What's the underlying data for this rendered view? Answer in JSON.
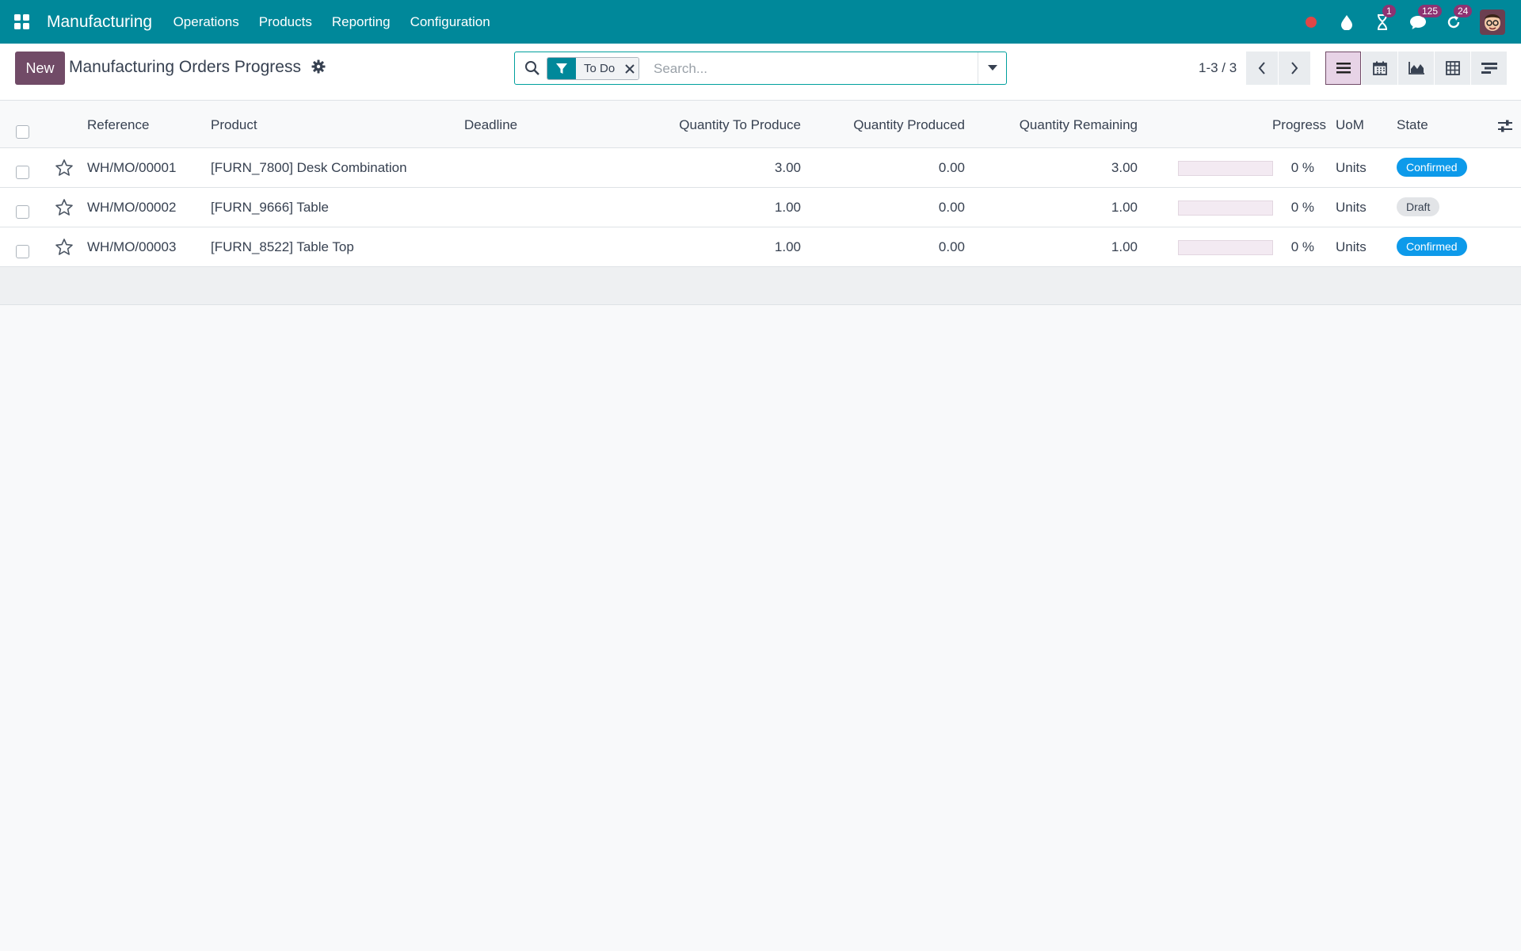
{
  "navbar": {
    "app_name": "Manufacturing",
    "menu": [
      "Operations",
      "Products",
      "Reporting",
      "Configuration"
    ],
    "badges": {
      "activities": "1",
      "messages": "125",
      "updates": "24"
    },
    "accent": "#00889a"
  },
  "control": {
    "new_label": "New",
    "title": "Manufacturing Orders Progress",
    "facet_label": "To Do",
    "search_placeholder": "Search...",
    "pager": "1-3 / 3"
  },
  "table": {
    "headers": {
      "reference": "Reference",
      "product": "Product",
      "deadline": "Deadline",
      "qty_to_produce": "Quantity To Produce",
      "qty_produced": "Quantity Produced",
      "qty_remaining": "Quantity Remaining",
      "progress": "Progress",
      "uom": "UoM",
      "state": "State"
    },
    "rows": [
      {
        "reference": "WH/MO/00001",
        "product": "[FURN_7800] Desk Combination",
        "deadline": "",
        "qty_to_produce": "3.00",
        "qty_produced": "0.00",
        "qty_remaining": "3.00",
        "progress": "0 %",
        "progress_value": 0,
        "uom": "Units",
        "state": "Confirmed",
        "state_kind": "confirmed"
      },
      {
        "reference": "WH/MO/00002",
        "product": "[FURN_9666] Table",
        "deadline": "",
        "qty_to_produce": "1.00",
        "qty_produced": "0.00",
        "qty_remaining": "1.00",
        "progress": "0 %",
        "progress_value": 0,
        "uom": "Units",
        "state": "Draft",
        "state_kind": "draft"
      },
      {
        "reference": "WH/MO/00003",
        "product": "[FURN_8522] Table Top",
        "deadline": "",
        "qty_to_produce": "1.00",
        "qty_produced": "0.00",
        "qty_remaining": "1.00",
        "progress": "0 %",
        "progress_value": 0,
        "uom": "Units",
        "state": "Confirmed",
        "state_kind": "confirmed"
      }
    ]
  },
  "colors": {
    "primary": "#714b67",
    "confirmed": "#0d9aea",
    "draft": "#e2e4e7"
  },
  "icons": [
    "apps-grid-icon",
    "record-dot-icon",
    "drop-icon",
    "hourglass-icon",
    "chat-icon",
    "refresh-icon",
    "gear-icon",
    "search-icon",
    "filter-icon",
    "close-icon",
    "caret-down-icon",
    "chevron-left-icon",
    "chevron-right-icon",
    "list-view-icon",
    "calendar-view-icon",
    "graph-view-icon",
    "pivot-view-icon",
    "gantt-view-icon",
    "star-icon",
    "sliders-icon"
  ]
}
